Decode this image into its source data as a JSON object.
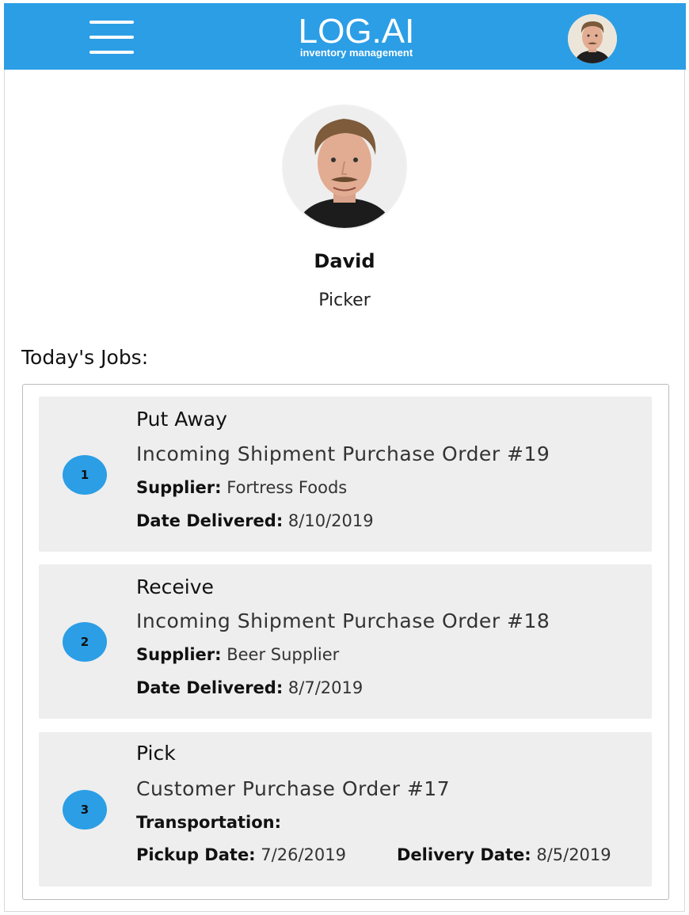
{
  "header": {
    "logo_title": "LOG.AI",
    "logo_subtitle": "inventory management",
    "menu_icon": "hamburger-icon",
    "accent_color": "#2b9ee5"
  },
  "profile": {
    "name": "David",
    "role": "Picker"
  },
  "jobs_section": {
    "title": "Today's Jobs:"
  },
  "jobs": [
    {
      "number": "1",
      "type": "Put Away",
      "order": "Incoming Shipment Purchase Order #19",
      "line1_label": "Supplier:",
      "line1_value": "Fortress Foods",
      "line2_label": "Date Delivered:",
      "line2_value": "8/10/2019"
    },
    {
      "number": "2",
      "type": "Receive",
      "order": "Incoming Shipment Purchase Order #18",
      "line1_label": "Supplier:",
      "line1_value": "Beer Supplier",
      "line2_label": "Date Delivered:",
      "line2_value": "8/7/2019"
    },
    {
      "number": "3",
      "type": "Pick",
      "order": "Customer Purchase Order #17",
      "line1_label": "Transportation:",
      "pickup_label": "Pickup Date:",
      "pickup_value": "7/26/2019",
      "delivery_label": "Delivery Date:",
      "delivery_value": "8/5/2019"
    }
  ]
}
